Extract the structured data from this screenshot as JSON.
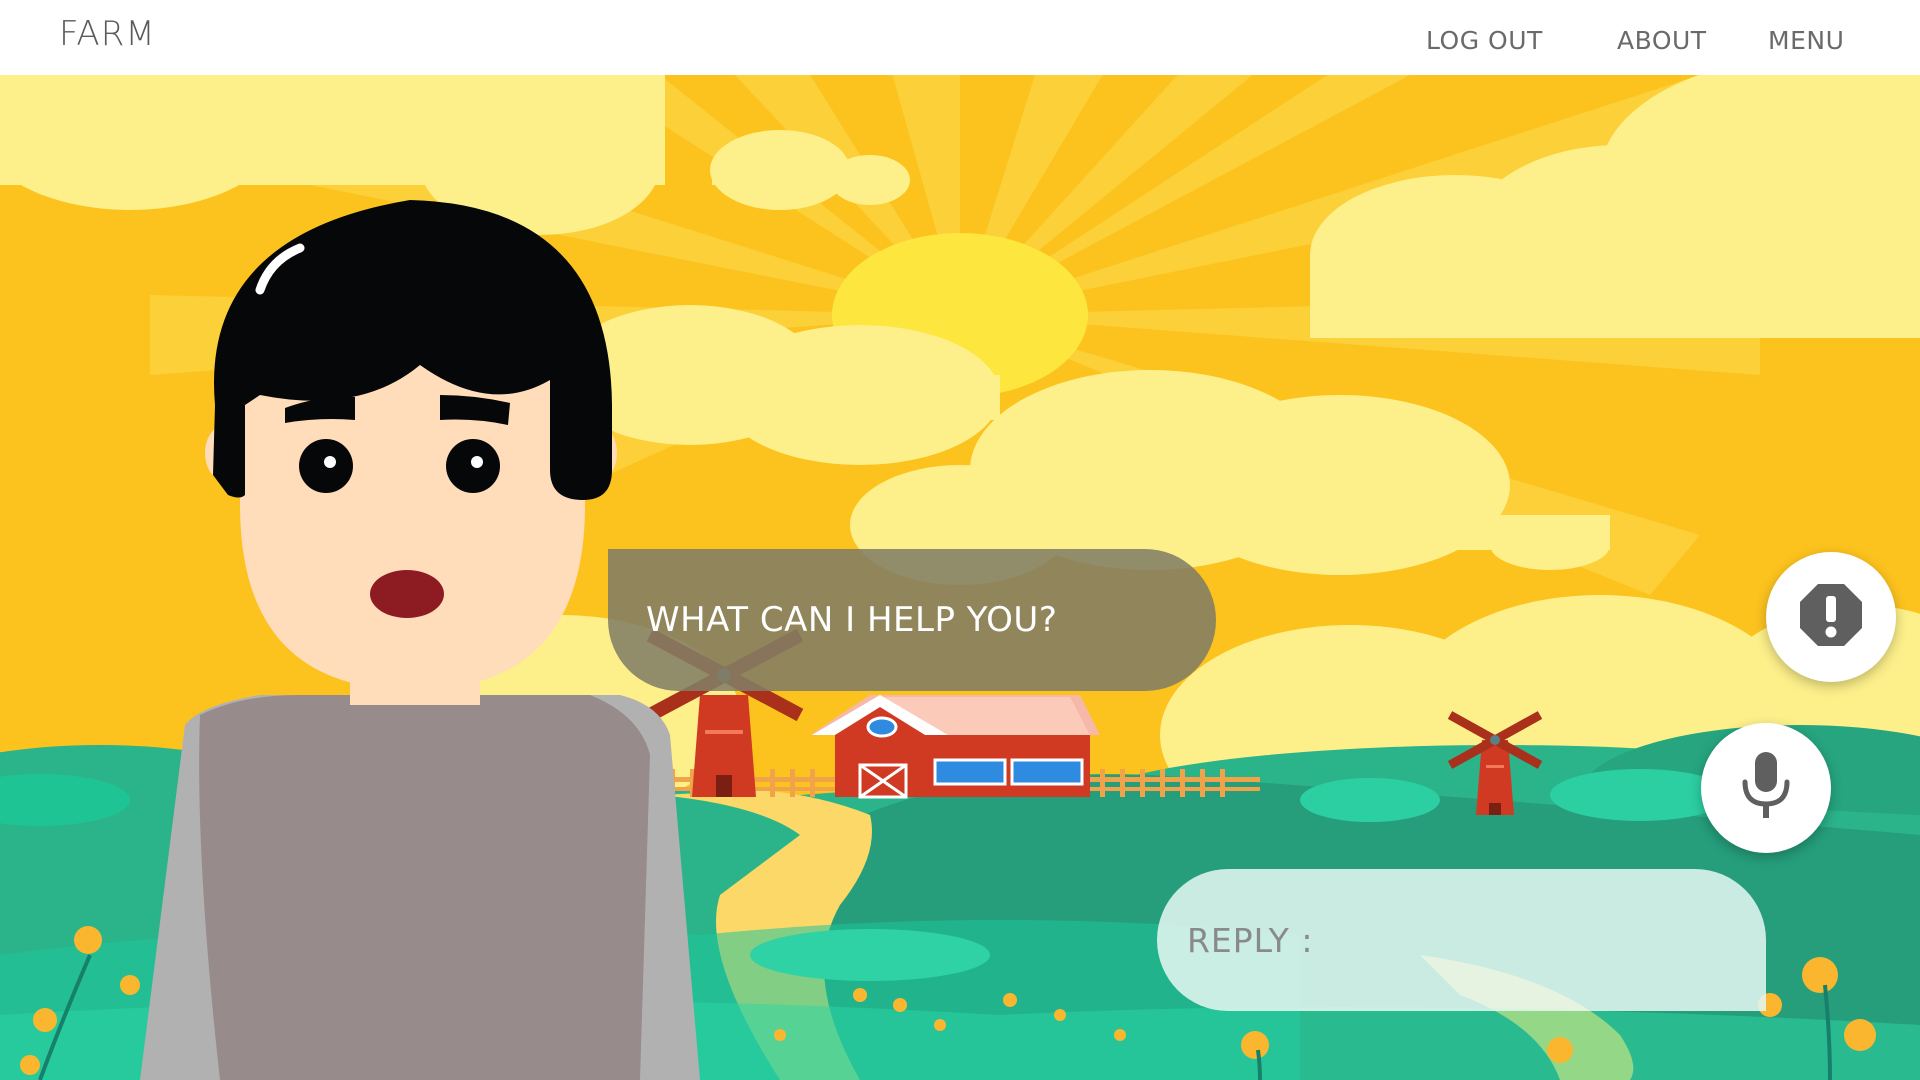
{
  "header": {
    "brand": "FARM",
    "nav": {
      "logout": "LOG OUT",
      "about": "ABOUT",
      "menu": "MENU"
    }
  },
  "chat": {
    "prompt": "WHAT CAN I HELP YOU?",
    "reply_label": "REPLY :"
  },
  "icons": {
    "alert": "alert-octagon-icon",
    "mic": "microphone-icon"
  },
  "colors": {
    "sky": "#fcc31e",
    "cloud": "#fdf08a",
    "sun": "#fde63e",
    "hill_green": "#2bb38a",
    "barn_red": "#d13a22",
    "speech_bubble": "#827d64",
    "reply_bubble": "#e1f6f0"
  }
}
